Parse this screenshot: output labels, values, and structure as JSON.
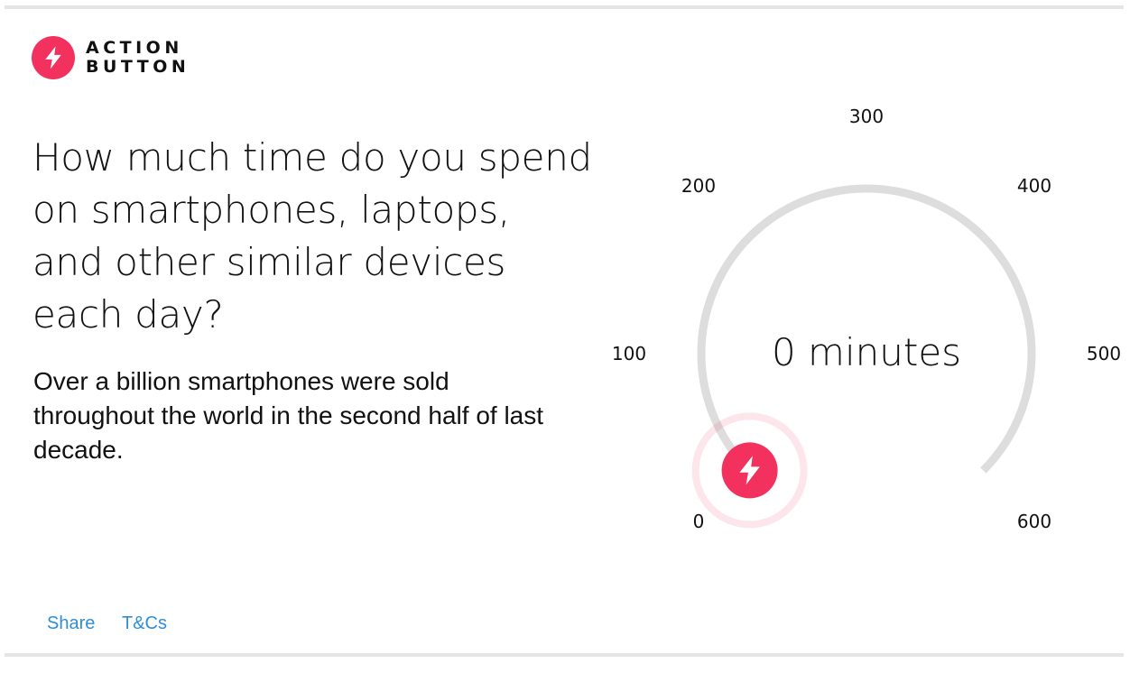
{
  "brand": {
    "line1": "ACTION",
    "line2": "BUTTON",
    "accent_color": "#f2315e",
    "icon": "lightning-bolt-icon"
  },
  "question": "How much time do you spend on smartphones, laptops, and other similar devices each day?",
  "blurb": "Over a billion smartphones were sold throughout the world in the second half of last decade.",
  "dial": {
    "value": 0,
    "value_text": "0 minutes",
    "min": 0,
    "max": 600,
    "ticks": [
      "0",
      "100",
      "200",
      "300",
      "400",
      "500",
      "600"
    ],
    "track_color": "#dddddd",
    "handle_color": "#f2315e",
    "handle_icon": "lightning-bolt-icon"
  },
  "footer": {
    "share": "Share",
    "terms": "T&Cs",
    "link_color": "#2d8fd9"
  }
}
